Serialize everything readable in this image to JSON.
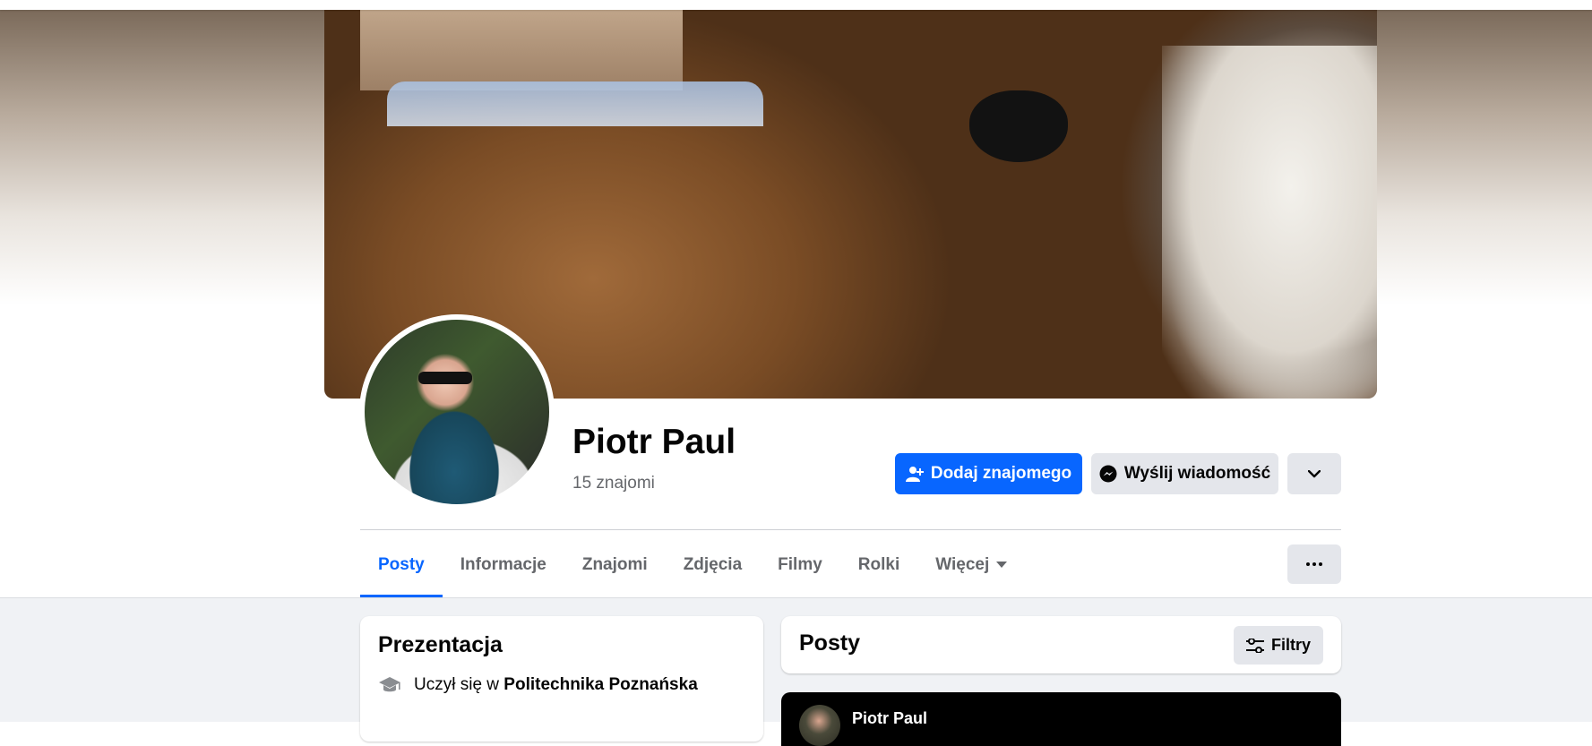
{
  "profile": {
    "name": "Piotr Paul",
    "friends_count": "15 znajomi"
  },
  "actions": {
    "add_friend": "Dodaj znajomego",
    "send_message": "Wyślij wiadomość",
    "more_icon": "chevron-down-icon"
  },
  "tabs": [
    {
      "label": "Posty",
      "active": true
    },
    {
      "label": "Informacje",
      "active": false
    },
    {
      "label": "Znajomi",
      "active": false
    },
    {
      "label": "Zdjęcia",
      "active": false
    },
    {
      "label": "Filmy",
      "active": false
    },
    {
      "label": "Rolki",
      "active": false
    },
    {
      "label": "Więcej",
      "active": false
    }
  ],
  "tabs_more_icon": "ellipsis-icon",
  "intro": {
    "title": "Prezentacja",
    "education_prefix": "Uczył się w",
    "education_school": "Politechnika Poznańska"
  },
  "posts": {
    "title": "Posty",
    "filters_label": "Filtry",
    "first_post_author": "Piotr Paul"
  },
  "colors": {
    "accent": "#0866ff",
    "secondary_button": "#e4e6eb",
    "feed_background": "#f0f2f5",
    "muted_text": "#65676b"
  }
}
